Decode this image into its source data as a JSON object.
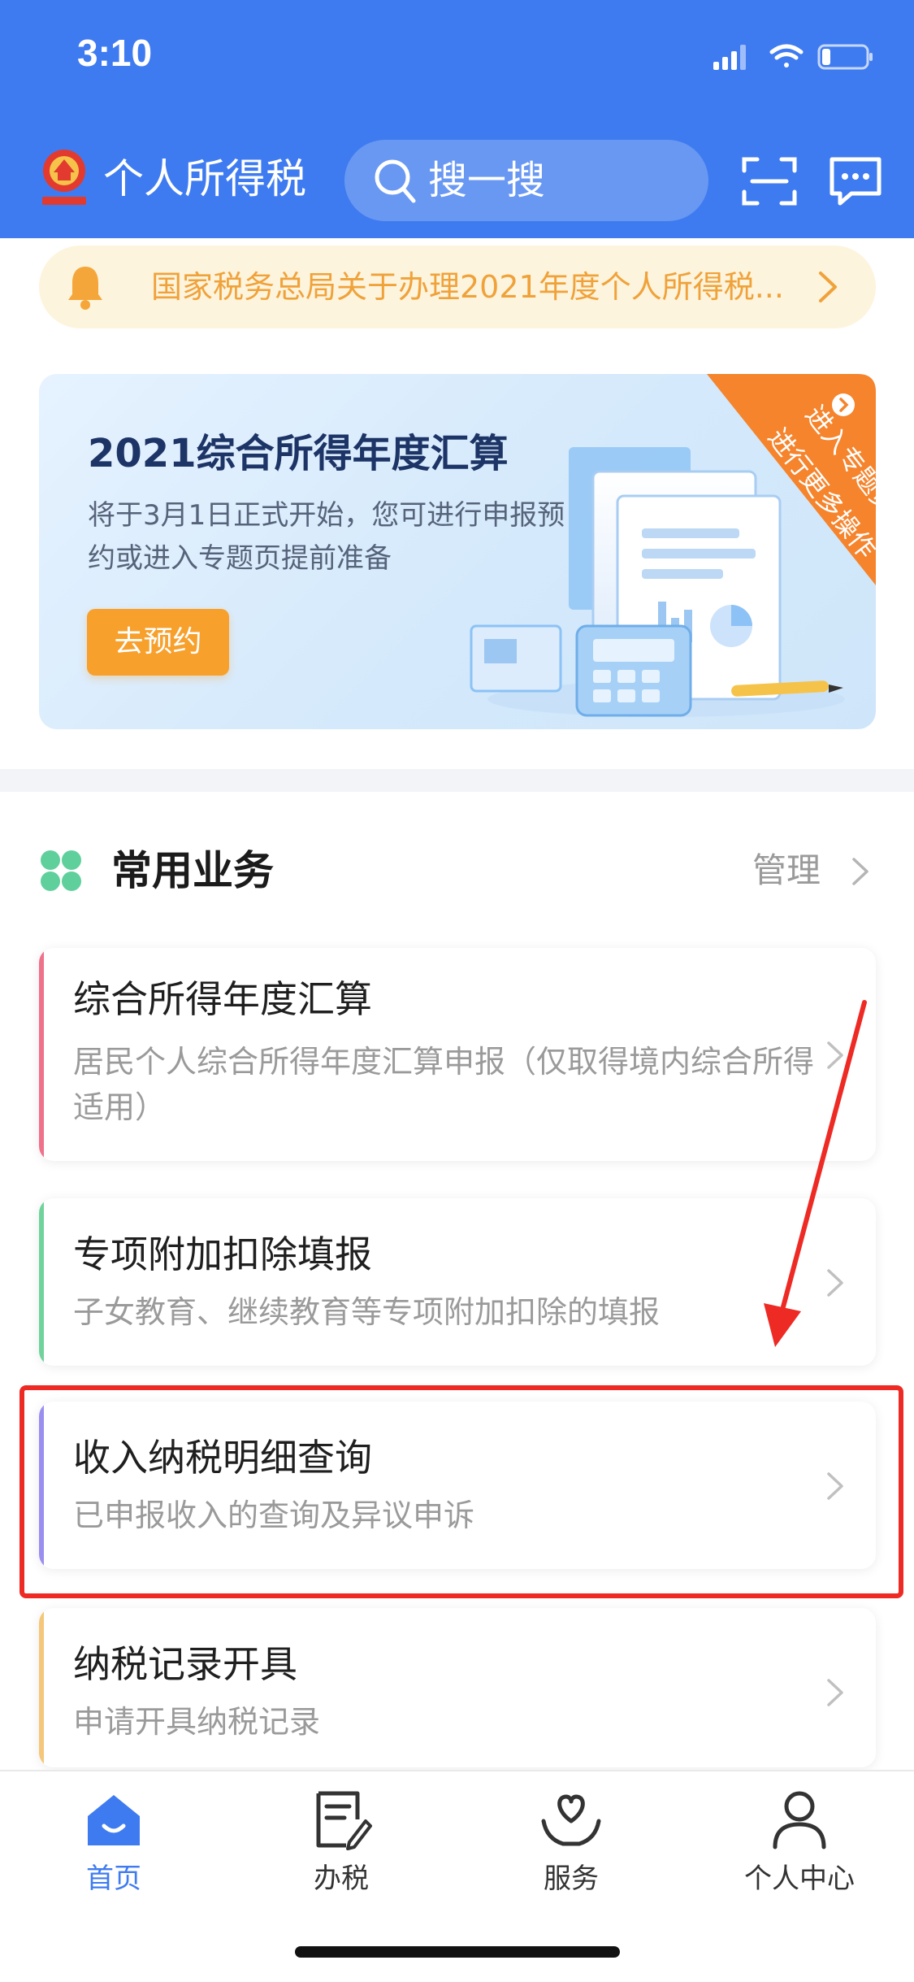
{
  "status_bar": {
    "time": "3:10"
  },
  "header": {
    "app_title": "个人所得税",
    "search_placeholder": "搜一搜"
  },
  "notice": {
    "text": "国家税务总局关于办理2021年度个人所得税..."
  },
  "banner": {
    "title": "2021综合所得年度汇算",
    "description": "将于3月1日正式开始，您可进行申报预约或进入专题页提前准备",
    "button_label": "去预约",
    "ribbon_line1": "进入专题页",
    "ribbon_line2": "进行更多操作"
  },
  "common_services": {
    "title": "常用业务",
    "manage_label": "管理",
    "items": [
      {
        "title": "综合所得年度汇算",
        "desc": "居民个人综合所得年度汇算申报（仅取得境内综合所得适用）",
        "accent": "#f0718a"
      },
      {
        "title": "专项附加扣除填报",
        "desc": "子女教育、继续教育等专项附加扣除的填报",
        "accent": "#6fd39b"
      },
      {
        "title": "收入纳税明细查询",
        "desc": "已申报收入的查询及异议申诉",
        "accent": "#9a8ef0"
      },
      {
        "title": "纳税记录开具",
        "desc": "申请开具纳税记录",
        "accent": "#f5c77a"
      }
    ]
  },
  "tabbar": {
    "items": [
      {
        "label": "首页",
        "icon": "home-icon",
        "active": true
      },
      {
        "label": "办税",
        "icon": "edit-document-icon",
        "active": false
      },
      {
        "label": "服务",
        "icon": "heart-hands-icon",
        "active": false
      },
      {
        "label": "个人中心",
        "icon": "person-icon",
        "active": false
      }
    ]
  },
  "colors": {
    "header_blue": "#3f7bf0",
    "notice_bg": "#fdf4dd",
    "notice_text": "#f0a23a",
    "button_orange": "#f7a02c",
    "annotation_red": "#ee2a24",
    "tab_active": "#3f7bf0",
    "tab_inactive": "#333333"
  }
}
